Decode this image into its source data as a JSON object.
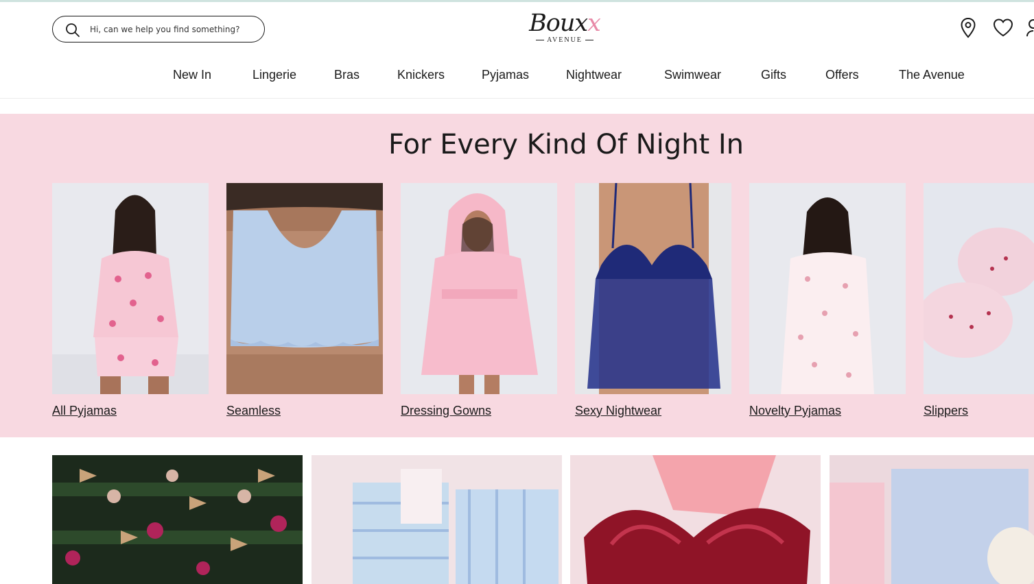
{
  "header": {
    "search_placeholder": "Hi, can we help you find something?",
    "logo_text": "Boux",
    "logo_sub": "AVENUE"
  },
  "nav": [
    "New In",
    "Lingerie",
    "Bras",
    "Knickers",
    "Pyjamas",
    "Nightwear",
    "Swimwear",
    "Gifts",
    "Offers",
    "The Avenue"
  ],
  "section": {
    "title": "For Every Kind Of Night In",
    "cards": [
      {
        "label": "All Pyjamas"
      },
      {
        "label": "Seamless"
      },
      {
        "label": "Dressing Gowns"
      },
      {
        "label": "Sexy Nightwear"
      },
      {
        "label": "Novelty Pyjamas"
      },
      {
        "label": "Slippers"
      }
    ]
  },
  "colors": {
    "pink_band": "#f8d9e1",
    "accent_pink": "#e88aa8",
    "text": "#1a1a1a"
  },
  "icons": [
    "search-icon",
    "location-pin-icon",
    "heart-icon",
    "account-icon"
  ]
}
